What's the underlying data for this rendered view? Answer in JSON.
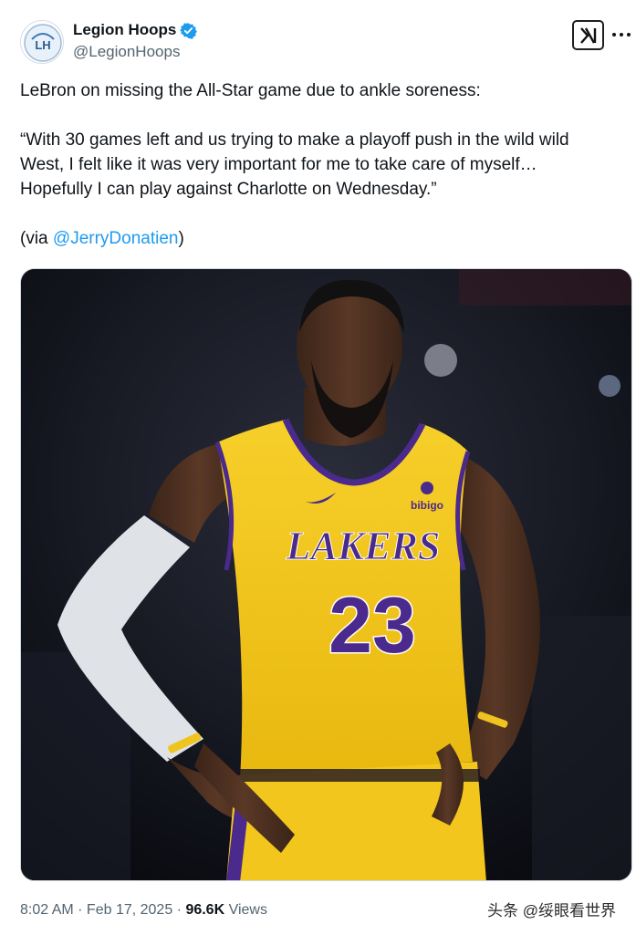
{
  "author": {
    "display_name": "Legion Hoops",
    "handle": "@LegionHoops",
    "verified": true,
    "avatar_icon": "legion-hoops-logo"
  },
  "header_actions": {
    "x_logo_icon": "x-logo-icon",
    "more_icon": "more-dots-icon"
  },
  "tweet": {
    "line1": "LeBron on missing the All-Star game due to ankle soreness:",
    "quote_line1": "“With 30 games left and us trying to make a playoff push in the wild wild",
    "quote_line2": "West, I felt like it was very important for me to take care of myself…",
    "quote_line3": "Hopefully I can play against Charlotte on Wednesday.”",
    "via_prefix": "(via ",
    "via_mention": "@JerryDonatien",
    "via_suffix": ")"
  },
  "media": {
    "jersey_team": "LAKERS",
    "jersey_number": "23",
    "sponsor": "bibigo"
  },
  "meta": {
    "time": "8:02 AM",
    "separator": " · ",
    "date": "Feb 17, 2025",
    "views_count": "96.6K",
    "views_label": " Views"
  },
  "watermark": "头条 @绥眼看世界",
  "colors": {
    "accent": "#1d9bf0",
    "jersey_gold": "#f5c518",
    "jersey_purple": "#4a2a8c"
  }
}
